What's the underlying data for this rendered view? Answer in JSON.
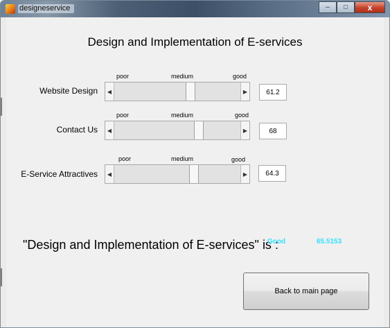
{
  "window": {
    "title": "designeservice",
    "controls": {
      "minimize": "–",
      "maximize": "□",
      "close": "x"
    }
  },
  "heading": "Design and Implementation of E-services",
  "ticks": {
    "poor": "poor",
    "medium": "medium",
    "good": "good"
  },
  "rows": [
    {
      "label": "Website Design",
      "value": "61.2",
      "level": 0.612
    },
    {
      "label": "Contact Us",
      "value": "68",
      "level": 0.68
    },
    {
      "label": "E-Service Attractives",
      "value": "64.3",
      "level": 0.643
    }
  ],
  "result": {
    "label": "\"Design and Implementation of E-services\" is :",
    "level": "Good",
    "score": "65.5153",
    "color": "#33e0ff"
  },
  "button": {
    "label": "Back to main page"
  },
  "colors": {
    "titlebar": "#4c5f75",
    "panel": "#f0f0f0"
  }
}
